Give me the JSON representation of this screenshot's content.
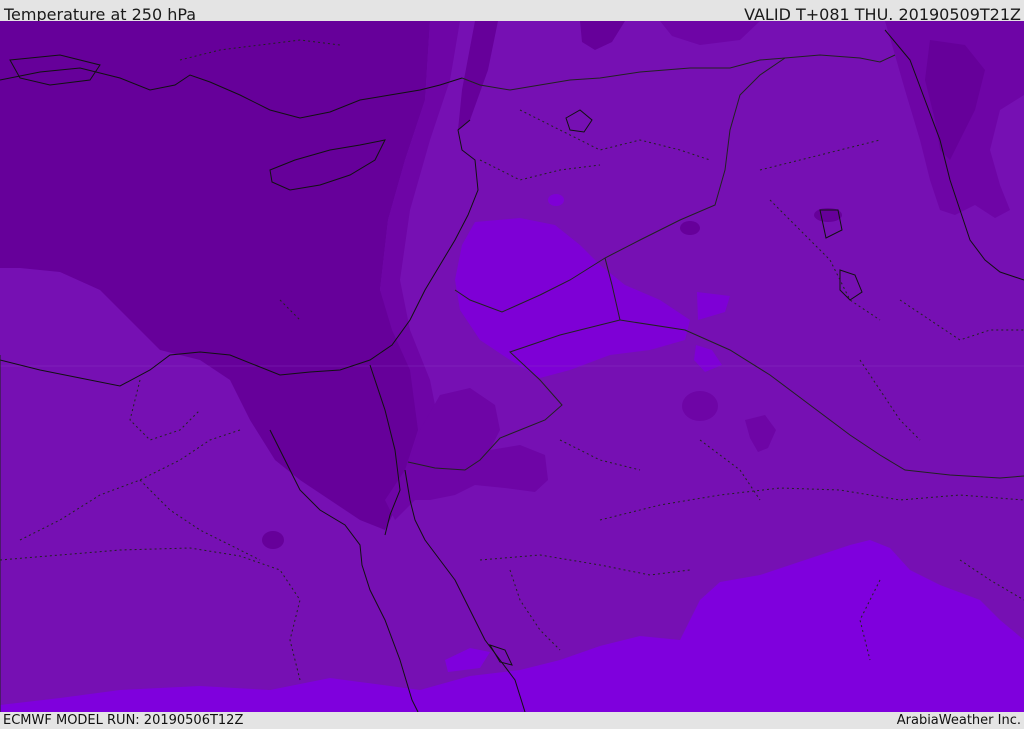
{
  "header": {
    "title": "Temperature at 250 hPa",
    "valid_time": "VALID T+081 THU. 20190509T21Z"
  },
  "footer": {
    "model_run": "ECMWF MODEL RUN: 20190506T12Z",
    "credit": "ArabiaWeather Inc."
  },
  "map": {
    "field": "temperature",
    "pressure_level_hpa": 250,
    "colors": {
      "coldest": "#66009a",
      "cold": "#6e05a6",
      "base": "#7610b3",
      "mid": "#7a12b6",
      "warm": "#7e00d6",
      "warmest": "#7f00dd",
      "coastline": "#111111",
      "border": "#222222"
    }
  }
}
